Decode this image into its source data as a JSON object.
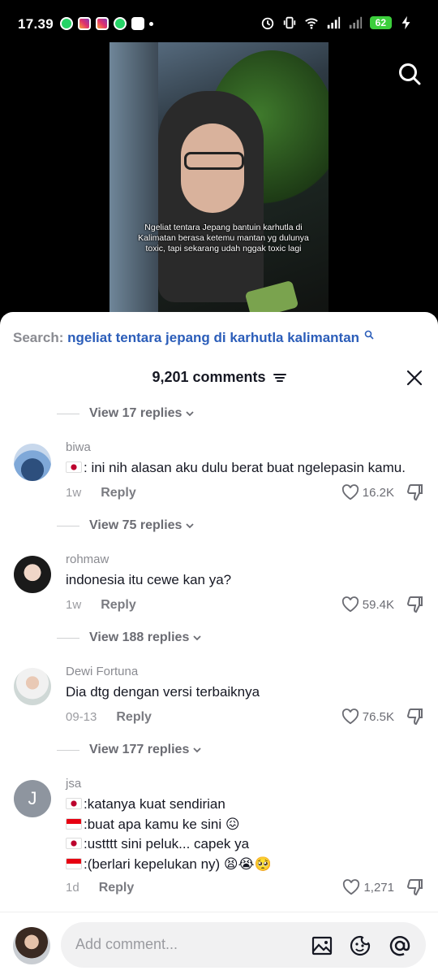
{
  "status_bar": {
    "time": "17.39",
    "battery": "62"
  },
  "video": {
    "caption": "Ngeliat tentara Jepang bantuin karhutla di Kalimatan berasa ketemu mantan yg dulunya toxic, tapi sekarang udah nggak toxic lagi"
  },
  "search": {
    "prefix": "Search:",
    "query": "ngeliat tentara jepang di karhutla kalimantan"
  },
  "header": {
    "title": "9,201 comments"
  },
  "view_replies": [
    "View 17 replies",
    "View 75 replies",
    "View 188 replies",
    "View 177 replies"
  ],
  "comments": [
    {
      "username": "biwa",
      "lines": [
        ": ini nih alasan aku dulu berat buat ngelepasin kamu."
      ],
      "time": "1w",
      "reply_label": "Reply",
      "likes": "16.2K"
    },
    {
      "username": "rohmaw",
      "lines": [
        "indonesia itu cewe kan ya?"
      ],
      "time": "1w",
      "reply_label": "Reply",
      "likes": "59.4K"
    },
    {
      "username": "Dewi Fortuna",
      "lines": [
        "Dia dtg dengan versi terbaiknya"
      ],
      "time": "09-13",
      "reply_label": "Reply",
      "likes": "76.5K"
    },
    {
      "username": "jsa",
      "avatar_letter": "J",
      "lines": [
        ":katanya kuat sendirian",
        ":buat apa kamu ke sini 😖",
        ":ustttt sini peluk... capek ya",
        ":(berlari kepelukan ny) 😫😭🥺"
      ],
      "time": "1d",
      "reply_label": "Reply",
      "likes": "1,271"
    }
  ],
  "composer": {
    "placeholder": "Add comment..."
  }
}
